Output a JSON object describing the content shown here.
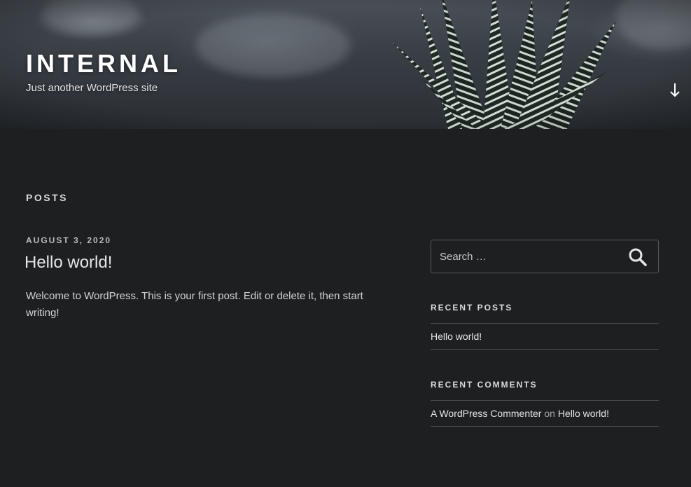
{
  "header": {
    "site_title": "INTERNAL",
    "tagline": "Just another WordPress site",
    "scroll_icon": "arrow-down-icon"
  },
  "main": {
    "page_heading": "POSTS",
    "post": {
      "date": "AUGUST 3, 2020",
      "title": "Hello world!",
      "excerpt": "Welcome to WordPress. This is your first post. Edit or delete it, then start writing!"
    }
  },
  "sidebar": {
    "search": {
      "placeholder": "Search …",
      "button_icon": "search-icon"
    },
    "recent_posts": {
      "title": "RECENT POSTS",
      "items": [
        "Hello world!"
      ]
    },
    "recent_comments": {
      "title": "RECENT COMMENTS",
      "items": [
        {
          "author": "A WordPress Commenter",
          "on": "on",
          "post": "Hello world!"
        }
      ]
    }
  },
  "colors": {
    "background": "#1d1f20",
    "text": "#e6e6e6",
    "border": "#444a4e"
  }
}
